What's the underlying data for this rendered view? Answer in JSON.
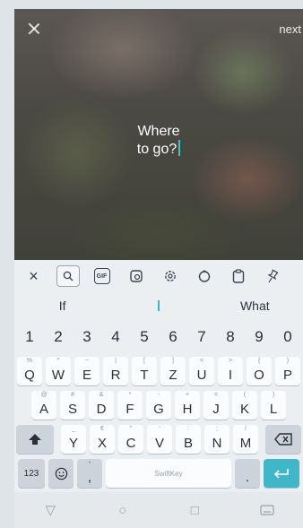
{
  "editor": {
    "next_label": "next",
    "caption_line1": "Where",
    "caption_line2": "to go?"
  },
  "keyboard": {
    "toolbar": {
      "close": "×",
      "gif": "GIF"
    },
    "suggestions": [
      "If",
      "What"
    ],
    "number_row": [
      "1",
      "2",
      "3",
      "4",
      "5",
      "6",
      "7",
      "8",
      "9",
      "0"
    ],
    "row1": [
      {
        "k": "Q",
        "h": "%"
      },
      {
        "k": "W",
        "h": "^"
      },
      {
        "k": "E",
        "h": "~"
      },
      {
        "k": "R",
        "h": "|"
      },
      {
        "k": "T",
        "h": "["
      },
      {
        "k": "Z",
        "h": "]"
      },
      {
        "k": "U",
        "h": "<"
      },
      {
        "k": "I",
        "h": ">"
      },
      {
        "k": "O",
        "h": "{"
      },
      {
        "k": "P",
        "h": "}"
      }
    ],
    "row2": [
      {
        "k": "A",
        "h": "@"
      },
      {
        "k": "S",
        "h": "#"
      },
      {
        "k": "D",
        "h": "&"
      },
      {
        "k": "F",
        "h": "*"
      },
      {
        "k": "G",
        "h": "-"
      },
      {
        "k": "H",
        "h": "+"
      },
      {
        "k": "J",
        "h": "="
      },
      {
        "k": "K",
        "h": "("
      },
      {
        "k": "L",
        "h": ")"
      }
    ],
    "row3": [
      {
        "k": "Y",
        "h": "_"
      },
      {
        "k": "X",
        "h": "€"
      },
      {
        "k": "C",
        "h": "\""
      },
      {
        "k": "V",
        "h": "'"
      },
      {
        "k": "B",
        "h": ":"
      },
      {
        "k": "N",
        "h": ";"
      },
      {
        "k": "M",
        "h": "/"
      }
    ],
    "bottom": {
      "mode_label": "123",
      "comma": ",",
      "space_brand": "SwiftKey",
      "period": "."
    }
  }
}
